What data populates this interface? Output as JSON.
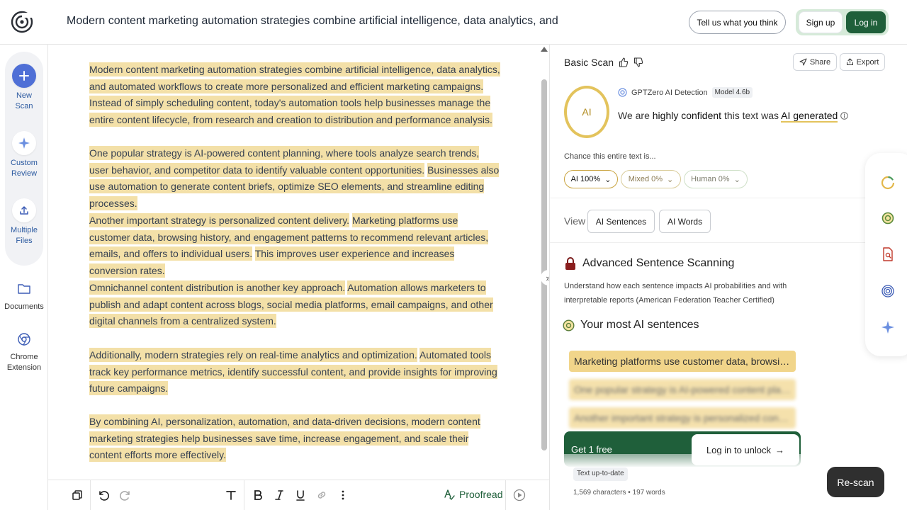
{
  "header": {
    "title": "Modern content marketing automation strategies combine artificial intelligence, data analytics, and",
    "feedback_label": "Tell us what you think",
    "signup_label": "Sign up",
    "login_label": "Log in"
  },
  "sidebar": {
    "items": [
      {
        "label_line1": "New",
        "label_line2": "Scan",
        "icon": "plus-icon"
      },
      {
        "label_line1": "Custom",
        "label_line2": "Review",
        "icon": "sparkle-icon"
      },
      {
        "label_line1": "Multiple",
        "label_line2": "Files",
        "icon": "upload-icon"
      },
      {
        "label_line1": "Documents",
        "label_line2": "",
        "icon": "folder-icon"
      },
      {
        "label_line1": "Chrome",
        "label_line2": "Extension",
        "icon": "chrome-icon"
      }
    ]
  },
  "editor": {
    "paragraphs": [
      [
        "Modern content marketing automation strategies combine artificial intelligence, data analytics, and automated workflows to create more personalized and efficient marketing campaigns.",
        "Instead of simply scheduling content, today's automation tools help businesses manage the entire content lifecycle, from research and creation to distribution and performance analysis."
      ],
      [
        "One popular strategy is AI-powered content planning, where tools analyze search trends, user behavior, and competitor data to identify valuable content opportunities.",
        "Businesses also use automation to generate content briefs, optimize SEO elements, and streamline editing processes."
      ],
      [
        "Another important strategy is personalized content delivery.",
        "Marketing platforms use customer data, browsing history, and engagement patterns to recommend relevant articles, emails, and offers to individual users.",
        "This improves user experience and increases conversion rates."
      ],
      [
        "Omnichannel content distribution is another key approach.",
        "Automation allows marketers to publish and adapt content across blogs, social media platforms, email campaigns, and other digital channels from a centralized system."
      ],
      [
        "Additionally, modern strategies rely on real-time analytics and optimization.",
        "Automated tools track key performance metrics, identify successful content, and provide insights for improving future campaigns."
      ],
      [
        "By combining AI, personalization, automation, and data-driven decisions, modern content marketing strategies help businesses save time, increase engagement, and scale their content efforts more effectively."
      ]
    ]
  },
  "toolbar": {
    "proofread_label": "Proofread"
  },
  "panel": {
    "scan_title": "Basic Scan",
    "share_label": "Share",
    "export_label": "Export",
    "ring_label": "AI",
    "detector_label": "GPTZero AI Detection",
    "model_label": "Model 4.6b",
    "verdict_prefix": "We are",
    "verdict_confidence": "highly confident",
    "verdict_middle": "this text was",
    "verdict_result": "AI generated",
    "chance_label": "Chance this entire text is...",
    "pills": [
      {
        "label": "AI 100%",
        "value": 100
      },
      {
        "label": "Mixed 0%",
        "value": 0
      },
      {
        "label": "Human 0%",
        "value": 0
      }
    ],
    "view_label": "View",
    "view_buttons": [
      "AI Sentences",
      "AI Words"
    ],
    "advanced_title": "Advanced Sentence Scanning",
    "advanced_desc": "Understand how each sentence impacts AI probabilities and with interpretable reports (American Federation Teacher Certified)",
    "most_title": "Your most AI sentences",
    "sentences": [
      "Marketing platforms use customer data, browsing h...",
      "One popular strategy is AI-powered content planni...",
      "Another important strategy is personalized content..."
    ],
    "unlock_free": "Get 1 free",
    "unlock_label": "Log in to unlock",
    "status_badge": "Text up-to-date",
    "char_count": "1,569 characters",
    "word_count": "197 words",
    "rescan_label": "Re-scan"
  },
  "colors": {
    "highlight": "#f3e0a8",
    "brand_green": "#1f5f3a",
    "ai_gold": "#e3c35c",
    "accent_blue": "#4f6fd6"
  }
}
